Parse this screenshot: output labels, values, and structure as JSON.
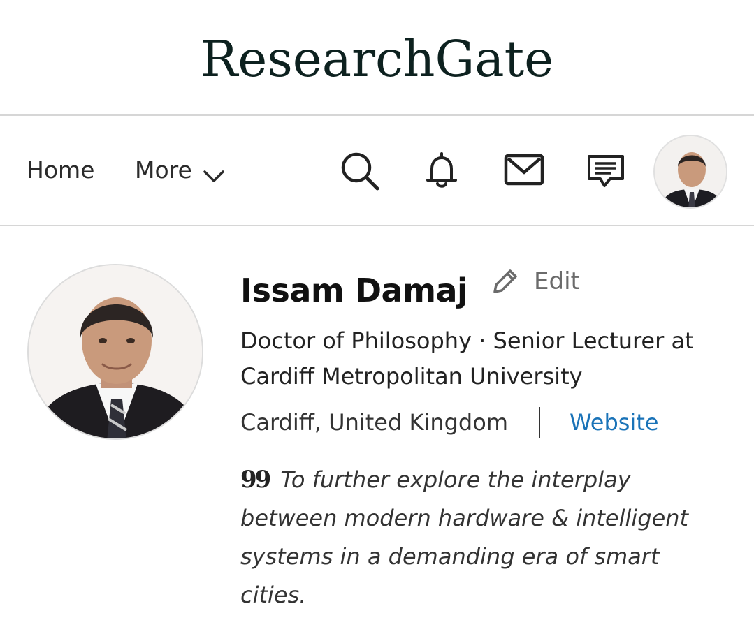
{
  "brand": {
    "logo_text": "ResearchGate"
  },
  "nav": {
    "home_label": "Home",
    "more_label": "More",
    "icons": [
      "search-icon",
      "bell-icon",
      "mail-icon",
      "chat-icon",
      "avatar"
    ]
  },
  "profile": {
    "name": "Issam Damaj",
    "edit_label": "Edit",
    "headline": "Doctor of Philosophy · Senior Lecturer at Cardiff Metropolitan University",
    "location": "Cardiff, United Kingdom",
    "website_label": "Website",
    "quote": "To further explore the interplay between modern hardware & intelligent systems in a demanding era of smart cities."
  },
  "colors": {
    "logo": "#0d211f",
    "link": "#1a73b8",
    "divider": "#d6d6d6"
  }
}
